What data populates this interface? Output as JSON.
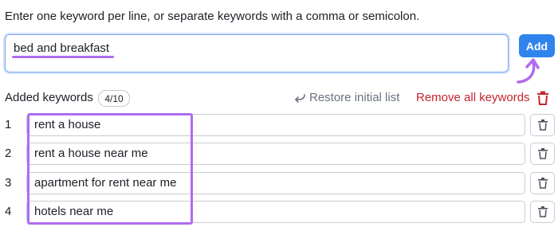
{
  "instructions": "Enter one keyword per line, or separate keywords with a comma or semicolon.",
  "input": {
    "value": "bed and breakfast"
  },
  "add_button": "Add",
  "added": {
    "label": "Added keywords",
    "count": "4/10"
  },
  "actions": {
    "restore": "Restore initial list",
    "remove_all": "Remove all keywords"
  },
  "rows": [
    {
      "num": "1",
      "keyword": "rent a house"
    },
    {
      "num": "2",
      "keyword": "rent a house near me"
    },
    {
      "num": "3",
      "keyword": "apartment for rent near me"
    },
    {
      "num": "4",
      "keyword": "hotels near me"
    }
  ],
  "colors": {
    "accent_blue": "#2f84ec",
    "highlight_purple": "#b06cf0",
    "danger_red": "#c5252f"
  },
  "icons": [
    "undo-arrow-icon",
    "trash-icon",
    "curved-arrow-icon"
  ]
}
